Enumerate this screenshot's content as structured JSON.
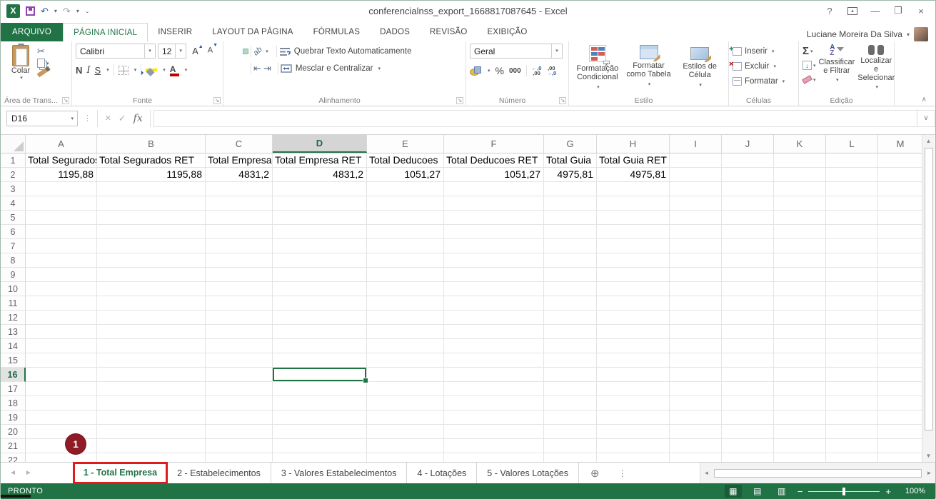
{
  "colors": {
    "excel_green": "#217346",
    "annotation_red": "#e11b1b",
    "badge_red": "#8e1b26",
    "highlight_yellow": "#ffe400",
    "font_color_red": "#c00000"
  },
  "icons": {
    "dropdown": "▾",
    "undo": "↶",
    "redo": "↷",
    "qat_more": "⌄",
    "help": "?",
    "minimize": "—",
    "maximize": "❐",
    "close": "×",
    "ribbon_options_arrow": "▴",
    "cut": "✂",
    "font_bigger": "A",
    "font_smaller": "A",
    "up_caret": "▲",
    "down_caret": "▼",
    "left_caret": "◄",
    "right_caret": "►",
    "indent_dec": "⇤",
    "indent_inc": "⇥",
    "orientation": "ab",
    "percent": "%",
    "thousands": "000",
    "dec_inc_top": "←,0",
    "dec_inc_bot": ",00",
    "dec_dec_top": ",00",
    "dec_dec_bot": "→,0",
    "neq": "≠",
    "sum": "Σ",
    "fill_down": "↓",
    "az_a": "A",
    "az_z": "Z",
    "cancel": "×",
    "confirm": "✓",
    "fx": "fx",
    "formula_expand": "∨",
    "ellipsis": "⋮",
    "new_sheet": "⊕",
    "launcher": "↘",
    "collapse_ribbon": "∧",
    "view_normal": "▦",
    "view_layout": "▤",
    "view_break": "▥",
    "zoom_out": "−",
    "zoom_in": "+"
  },
  "title_bar": {
    "title": "conferencialnss_export_1668817087645 - Excel",
    "logo_letter": "X"
  },
  "ribbon_tabs": {
    "file": "ARQUIVO",
    "items": [
      "PÁGINA INICIAL",
      "INSERIR",
      "LAYOUT DA PÁGINA",
      "FÓRMULAS",
      "DADOS",
      "REVISÃO",
      "EXIBIÇÃO"
    ],
    "active": "PÁGINA INICIAL",
    "user": "Luciane Moreira Da Silva"
  },
  "ribbon": {
    "clipboard": {
      "paste": "Colar",
      "label": "Área de Trans..."
    },
    "font": {
      "family": "Calibri",
      "size": "12",
      "bold": "N",
      "italic": "I",
      "underline": "S",
      "color_letter": "A",
      "label": "Fonte"
    },
    "alignment": {
      "wrap": "Quebrar Texto Automaticamente",
      "merge": "Mesclar e Centralizar",
      "label": "Alinhamento"
    },
    "number": {
      "format": "Geral",
      "label": "Número"
    },
    "style": {
      "conditional": "Formatação Condicional",
      "table": "Formatar como Tabela",
      "cell_styles": "Estilos de Célula",
      "label": "Estilo"
    },
    "cells": {
      "insert": "Inserir",
      "delete": "Excluir",
      "format": "Formatar",
      "label": "Células"
    },
    "editing": {
      "sort": "Classificar e Filtrar",
      "find": "Localizar e Selecionar",
      "label": "Edição"
    }
  },
  "formula_bar": {
    "name_box": "D16",
    "value": ""
  },
  "sheet": {
    "columns": [
      "A",
      "B",
      "C",
      "D",
      "E",
      "F",
      "G",
      "H",
      "I",
      "J",
      "K",
      "L",
      "M"
    ],
    "selected_column": "D",
    "selected_row": 16,
    "selected_cell": "D16",
    "visible_rows": 22,
    "header_row": [
      "Total Segurados",
      "Total Segurados RET",
      "Total Empresa",
      "Total Empresa RET",
      "Total Deducoes",
      "Total Deducoes RET",
      "Total Guia",
      "Total Guia RET"
    ],
    "values_row": [
      "1195,88",
      "1195,88",
      "4831,2",
      "4831,2",
      "1051,27",
      "1051,27",
      "4975,81",
      "4975,81"
    ]
  },
  "sheet_tabs": {
    "items": [
      "1 - Total Empresa",
      "2 - Estabelecimentos",
      "3 - Valores Estabelecimentos",
      "4 - Lotações",
      "5 - Valores Lotações"
    ],
    "active": "1 - Total Empresa",
    "annotation_badge": "1"
  },
  "status_bar": {
    "mode": "PRONTO",
    "zoom": "100%"
  }
}
